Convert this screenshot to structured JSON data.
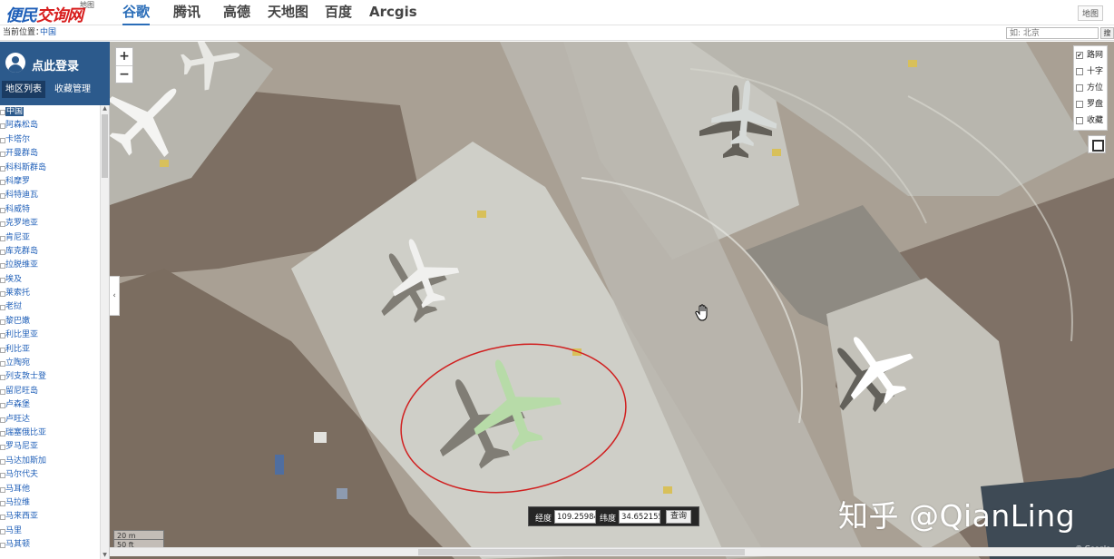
{
  "app": {
    "logo_text_part1": "便民",
    "logo_text_part2": "交询网",
    "logo_sub": "地图"
  },
  "tabs": [
    {
      "label": "谷歌",
      "active": true
    },
    {
      "label": "腾讯",
      "active": false
    },
    {
      "label": "高德",
      "active": false
    },
    {
      "label": "天地图",
      "active": false
    },
    {
      "label": "百度",
      "active": false
    },
    {
      "label": "Arcgis",
      "active": false
    }
  ],
  "topbar": {
    "right_button": "地图"
  },
  "location": {
    "label": "当前位置：",
    "value": "中国"
  },
  "search": {
    "placeholder": "如: 北京",
    "button": "搜"
  },
  "sidebar": {
    "login": "点此登录",
    "tabs": [
      "地区列表",
      "收藏管理"
    ],
    "regions": [
      "中国",
      "阿森松岛",
      "卡塔尔",
      "开曼群岛",
      "科科斯群岛",
      "科摩罗",
      "科特迪瓦",
      "科威特",
      "克罗地亚",
      "肯尼亚",
      "库克群岛",
      "拉脱维亚",
      "埃及",
      "莱索托",
      "老挝",
      "黎巴嫩",
      "利比里亚",
      "利比亚",
      "立陶宛",
      "列支敦士登",
      "留尼旺岛",
      "卢森堡",
      "卢旺达",
      "瑞塞俄比亚",
      "罗马尼亚",
      "马达加斯加",
      "马尔代夫",
      "马耳他",
      "马拉维",
      "马来西亚",
      "马里",
      "马其顿"
    ]
  },
  "map": {
    "layers": [
      {
        "label": "路网",
        "checked": true
      },
      {
        "label": "十字",
        "checked": false
      },
      {
        "label": "方位",
        "checked": false
      },
      {
        "label": "罗盘",
        "checked": false
      },
      {
        "label": "收藏",
        "checked": false
      }
    ],
    "zoom_in": "+",
    "zoom_out": "−",
    "collapse": "‹",
    "coords": {
      "lon_label": "经度",
      "lon_value": "109.25984",
      "lat_label": "纬度",
      "lat_value": "34.6521556",
      "button": "查询"
    },
    "scale": [
      "20 m",
      "50 ft"
    ],
    "copyright": "© Google",
    "watermark": "知乎 @QianLing"
  }
}
